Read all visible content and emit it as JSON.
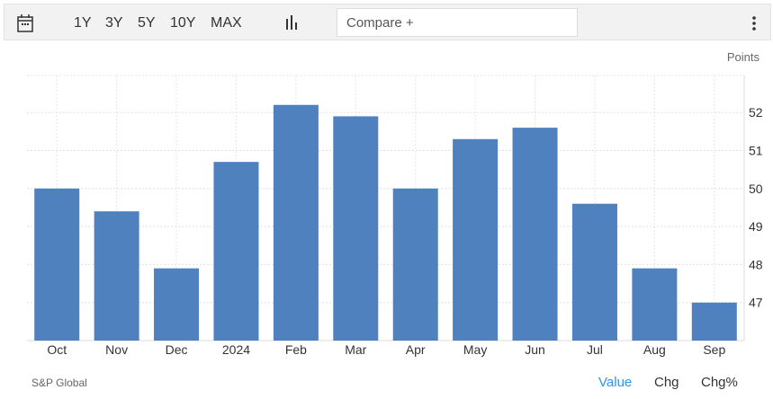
{
  "toolbar": {
    "ranges": [
      "1Y",
      "3Y",
      "5Y",
      "10Y",
      "MAX"
    ],
    "compare_placeholder": "Compare +"
  },
  "unit_label": "Points",
  "source": "S&P Global",
  "modes": [
    "Value",
    "Chg",
    "Chg%"
  ],
  "active_mode": "Value",
  "colors": {
    "bar": "#4e81bd",
    "active": "#2b95f5"
  },
  "chart_data": {
    "type": "bar",
    "categories": [
      "Oct",
      "Nov",
      "Dec",
      "2024",
      "Feb",
      "Mar",
      "Apr",
      "May",
      "Jun",
      "Jul",
      "Aug",
      "Sep"
    ],
    "values": [
      50.0,
      49.4,
      47.9,
      50.7,
      52.2,
      51.9,
      50.0,
      51.3,
      51.6,
      49.6,
      47.9,
      47.0
    ],
    "ylabel": "Points",
    "yticks": [
      47,
      48,
      49,
      50,
      51,
      52
    ],
    "ylim": [
      46,
      53
    ],
    "grid": true
  }
}
